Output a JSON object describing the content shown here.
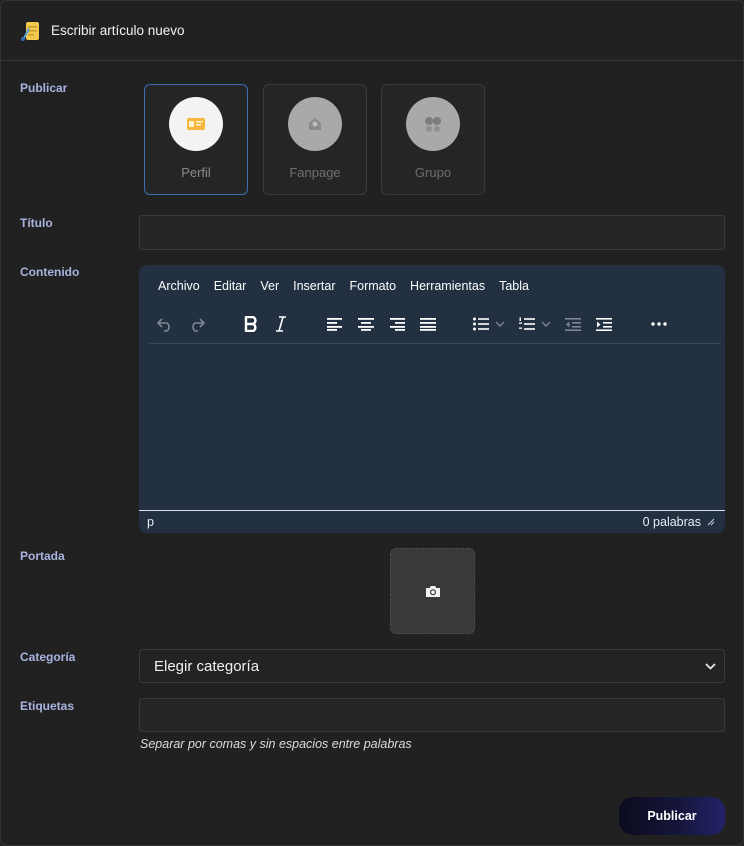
{
  "header": {
    "title": "Escribir artículo nuevo",
    "icon": "quill-document-icon"
  },
  "publish": {
    "label": "Publicar",
    "options": [
      {
        "label": "Perfil",
        "icon": "id-card-icon",
        "selected": true
      },
      {
        "label": "Fanpage",
        "icon": "fanpage-icon",
        "selected": false
      },
      {
        "label": "Grupo",
        "icon": "group-icon",
        "selected": false
      }
    ]
  },
  "title_field": {
    "label": "Título",
    "value": ""
  },
  "content": {
    "label": "Contenido",
    "menu": [
      "Archivo",
      "Editar",
      "Ver",
      "Insertar",
      "Formato",
      "Herramientas",
      "Tabla"
    ],
    "toolbar": [
      "undo-icon",
      "redo-icon",
      "bold-icon",
      "italic-icon",
      "align-left-icon",
      "align-center-icon",
      "align-right-icon",
      "align-justify-icon",
      "bullet-list-icon",
      "numbered-list-icon",
      "outdent-icon",
      "indent-icon",
      "more-icon"
    ],
    "status_path": "p",
    "word_count": "0 palabras"
  },
  "cover": {
    "label": "Portada",
    "icon": "camera-icon"
  },
  "category": {
    "label": "Categoría",
    "selected": "Elegir categoría"
  },
  "tags": {
    "label": "Etiquetas",
    "value": "",
    "hint": "Separar por comas y sin espacios entre palabras"
  },
  "submit": {
    "label": "Publicar"
  },
  "colors": {
    "accent": "#3e6db6",
    "editor_bg": "#223041",
    "label": "#a9b3e0"
  }
}
